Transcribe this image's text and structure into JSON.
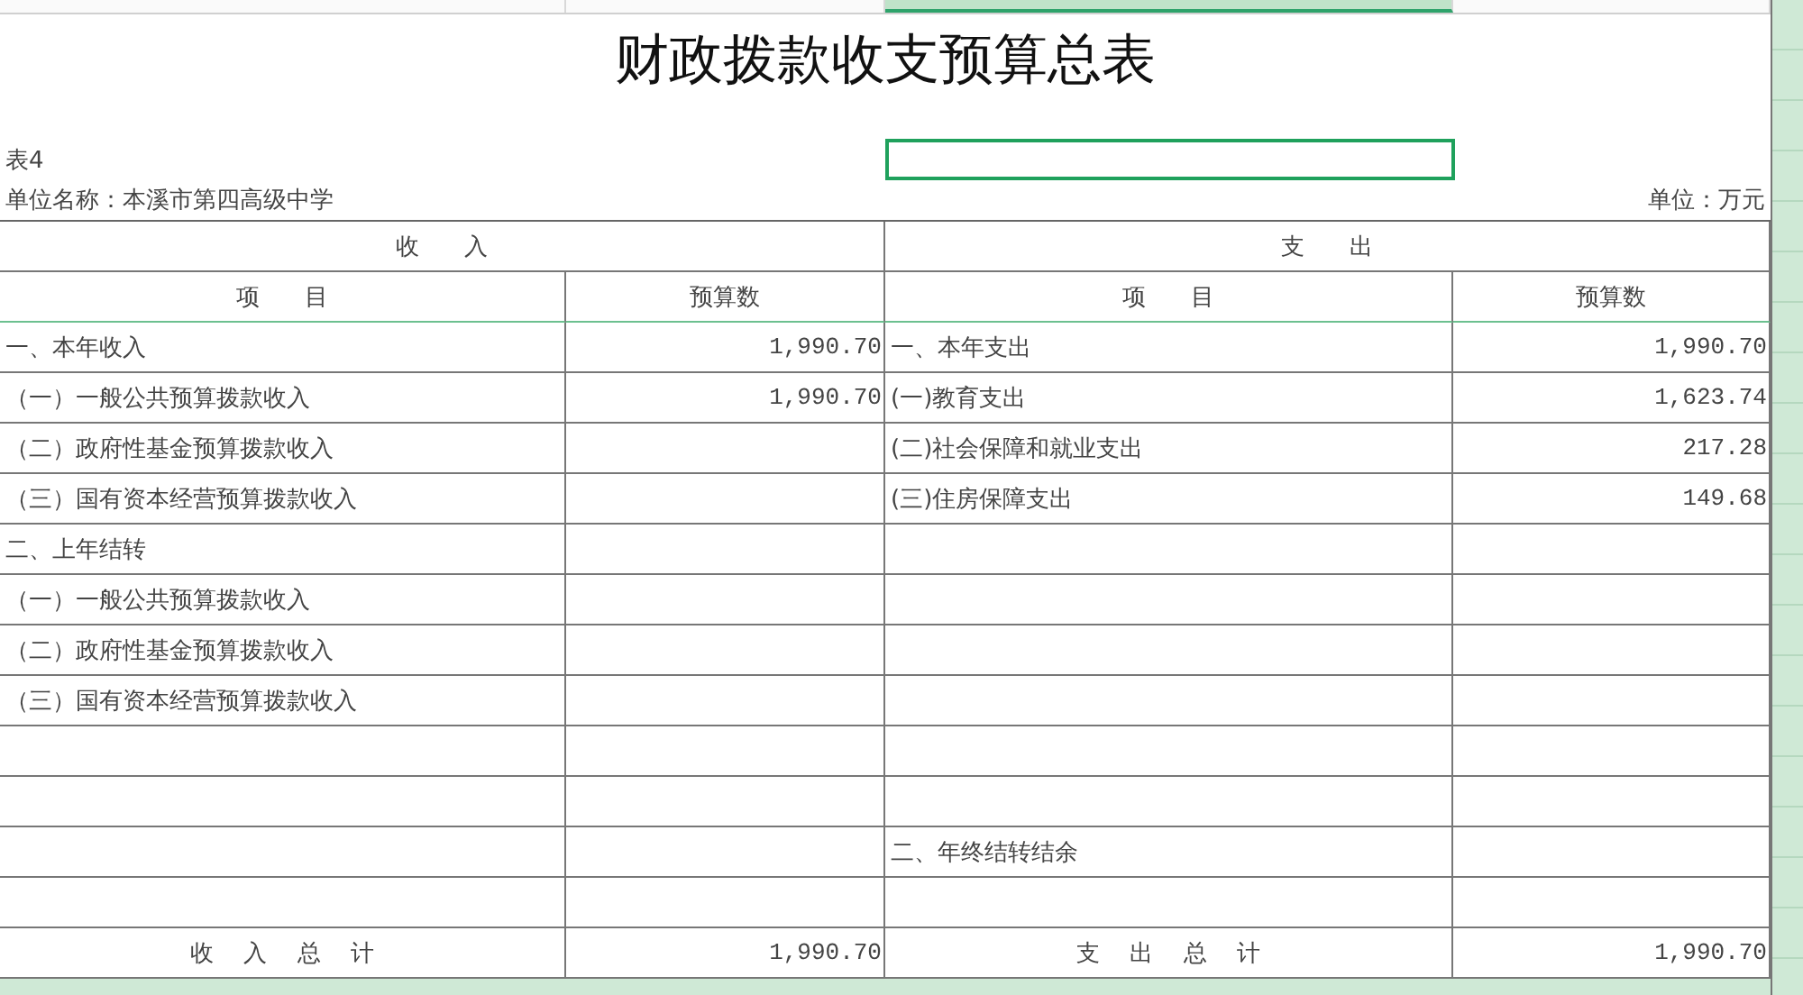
{
  "title": "财政拨款收支预算总表",
  "note_row": {
    "label": "表4",
    "selected_cell": {
      "selected": true
    }
  },
  "unit_name": "单位名称：本溪市第四高级中学",
  "unit": "单位：万元",
  "sections": [
    {
      "title": "收      入"
    },
    {
      "title": "支      出"
    }
  ],
  "columns": [
    "项      目",
    "预算数",
    "项      目",
    "预算数"
  ],
  "rows": [
    {
      "income_item": "一、本年收入",
      "income_amount": "1,990.70",
      "expense_item": "一、本年支出",
      "expense_amount": "1,990.70"
    },
    {
      "income_item": "（一）一般公共预算拨款收入",
      "income_amount": "1,990.70",
      "expense_item": "(一)教育支出",
      "expense_amount": "1,623.74"
    },
    {
      "income_item": "（二）政府性基金预算拨款收入",
      "expense_item": "(二)社会保障和就业支出",
      "expense_amount": "217.28"
    },
    {
      "income_item": "（三）国有资本经营预算拨款收入",
      "expense_item": "(三)住房保障支出",
      "expense_amount": "149.68"
    },
    {
      "income_item": "二、上年结转"
    },
    {
      "income_item": "（一）一般公共预算拨款收入"
    },
    {
      "income_item": "（二）政府性基金预算拨款收入"
    },
    {
      "income_item": "（三）国有资本经营预算拨款收入"
    },
    {},
    {},
    {
      "expense_item": "二、年终结转结余"
    },
    {}
  ],
  "totals": {
    "income_label": "收    入    总    计",
    "income_amount": "1,990.70",
    "expense_label": "支    出    总    计",
    "expense_amount": "1,990.70"
  }
}
